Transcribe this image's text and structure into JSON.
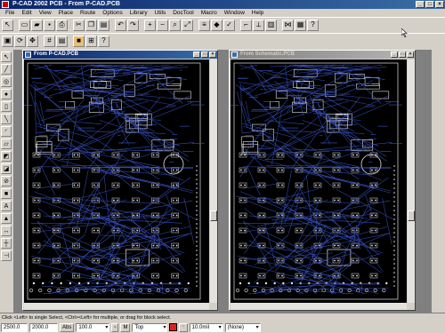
{
  "app": {
    "title": "P-CAD 2002 PCB - From P-CAD.PCB"
  },
  "menu": [
    "File",
    "Edit",
    "View",
    "Place",
    "Route",
    "Options",
    "Library",
    "Utils",
    "DocTool",
    "Macro",
    "Window",
    "Help"
  ],
  "toolbar1": [
    "new-icon",
    "open-icon",
    "save-icon",
    "print-icon",
    "cut-icon",
    "copy-icon",
    "paste-icon",
    "undo-icon",
    "redo-icon",
    "zoom-in-icon",
    "zoom-out-icon",
    "layer-icon",
    "highlight-icon",
    "drc-icon"
  ],
  "toolbar2": [
    "view-all-icon",
    "redraw-icon",
    "pan-icon",
    "grid-icon",
    "layer-set-icon",
    "select-icon",
    "measure-icon"
  ],
  "left_tools": [
    "select-icon",
    "route-icon",
    "via-icon",
    "pad-icon",
    "component-icon",
    "line-icon",
    "arc-icon",
    "polygon-icon",
    "copper-pour-icon",
    "cutout-icon",
    "keepout-icon",
    "text-icon",
    "attribute-icon",
    "dimension-icon",
    "point-icon",
    "ruler-icon"
  ],
  "windows": [
    {
      "title": "From P-CAD.PCB",
      "active": true
    },
    {
      "title": "From Schematic.PCB",
      "active": false
    }
  ],
  "colors": {
    "trace": "#3b55c9",
    "pad": "#e8e8e8",
    "board": "#000000",
    "accent": "#0a246a"
  },
  "status": {
    "message": "Click <Left> to single Select, <Ctrl><Left> for multiple, or drag for block select.",
    "x": "2500.0",
    "y": "2000.0",
    "abs_label": "Abs",
    "grid": "100.0",
    "layer": "Top",
    "line_width": "10.0mil",
    "style": "(None)"
  }
}
